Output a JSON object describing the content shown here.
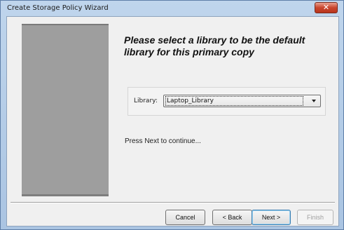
{
  "window": {
    "title": "Create Storage Policy Wizard",
    "close_label": "✕"
  },
  "main": {
    "heading": "Please select a library to be the default library for this primary copy",
    "library_label": "Library:",
    "library_value": "Laptop_Library",
    "hint": "Press Next to continue..."
  },
  "buttons": {
    "cancel": "Cancel",
    "back": "< Back",
    "next": "Next >",
    "finish": "Finish"
  }
}
